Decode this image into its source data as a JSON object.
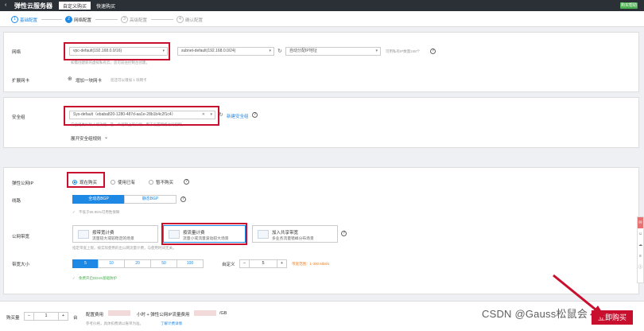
{
  "header": {
    "back_icon": "arrow-left-icon",
    "title": "弹性云服务器",
    "tabs": [
      {
        "label": "自定义购买"
      },
      {
        "label": "快速购买"
      }
    ],
    "help_label": "购买帮助"
  },
  "steps": [
    {
      "num": "1",
      "label": "基础配置"
    },
    {
      "num": "2",
      "label": "网络配置"
    },
    {
      "num": "3",
      "label": "高级配置"
    },
    {
      "num": "4",
      "label": "确认配置"
    }
  ],
  "network": {
    "label": "网络",
    "vpc_value": "vpc-default(192.168.0.0/16)",
    "subnet_value": "subnet-default(192.168.0.0/24)",
    "ip_mode": "自动分配IP地址",
    "ip_available": "可用私有IP数量248个",
    "hint": "如需创建新的虚拟私有云，您可前往控制台创建。",
    "ext_nic_label": "扩展网卡",
    "add_nic": "增加一块网卡",
    "add_nic_hint": "您还可以增加 1 块网卡"
  },
  "security": {
    "label": "安全组",
    "value": "Sys-default（ebaba820-1280-487d-aa1e-28b1b4c2f1c4）",
    "new_label": "新建安全组",
    "hint": "安全组类似防火墙功能，是一个逻辑上的分组，用于设置网络访问控制。",
    "expand_rules": "展开安全组规则"
  },
  "eip": {
    "label": "弹性公网IP",
    "options": [
      {
        "label": "现在购买"
      },
      {
        "label": "使用已有"
      },
      {
        "label": "暂不购买"
      }
    ],
    "line_label": "线路",
    "lines": [
      {
        "label": "全动态BGP"
      },
      {
        "label": "静态BGP"
      }
    ],
    "line_hint": "不低于99.95%可用性保障",
    "bandwidth_label": "公网带宽",
    "cards": [
      {
        "title": "按带宽计费",
        "desc": "流量较大或较稳定的场景"
      },
      {
        "title": "按流量计费",
        "desc": "流量小或流量波动较大场景"
      },
      {
        "title": "加入共享带宽",
        "desc": "多业务流量错峰分布场景"
      }
    ],
    "billing_hint": "指定带宽上限，按实际使用的出公网流量计费，与使用时间无关。",
    "size_label": "带宽大小",
    "sizes": [
      "5",
      "10",
      "20",
      "50",
      "100"
    ],
    "custom_label": "自定义",
    "custom_value": "5",
    "range_hint": "带宽范围：1-300 Mbit/s",
    "ddos_hint": "免费开启DDoS基础防护"
  },
  "footer": {
    "qty_label": "购买量",
    "qty_value": "1",
    "qty_unit": "台",
    "fee_label": "配置费用",
    "fee_unit": "小时 + 弹性公网IP流量费用",
    "fee_unit2": "/GB",
    "ref_hint": "参考价格，具体扣费请以账单为准。",
    "price_link": "了解计费详情",
    "buy_label": "立即购买"
  },
  "watermark": "CSDN @Gauss松鼠会"
}
